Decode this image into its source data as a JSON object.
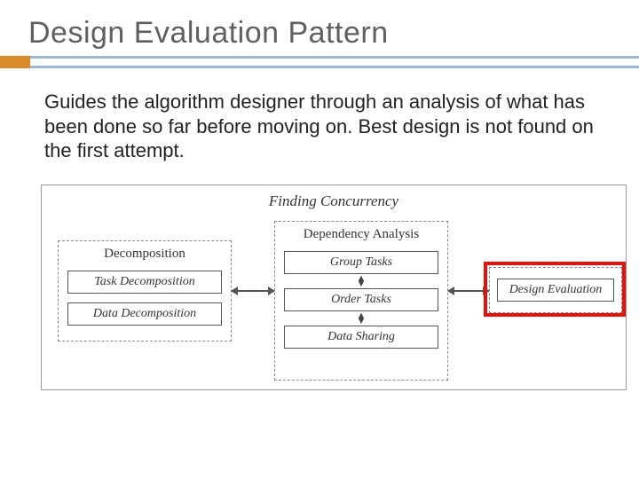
{
  "title": "Design Evaluation Pattern",
  "body": "Guides the algorithm designer through an analysis of what has been done so far before moving on. Best design is not found on the first attempt.",
  "diagram": {
    "header": "Finding Concurrency",
    "decomposition": {
      "label": "Decomposition",
      "nodes": [
        "Task Decomposition",
        "Data Decomposition"
      ]
    },
    "dependency": {
      "label": "Dependency Analysis",
      "nodes": [
        "Group Tasks",
        "Order Tasks",
        "Data Sharing"
      ]
    },
    "design_eval": {
      "node": "Design Evaluation"
    }
  }
}
